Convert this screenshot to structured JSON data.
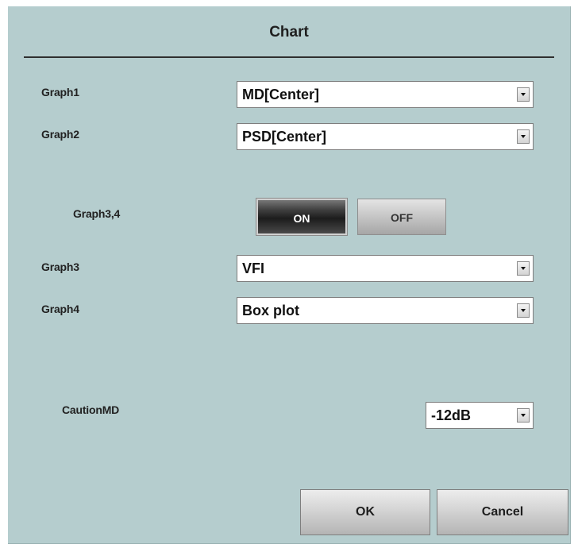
{
  "dialog": {
    "title": "Chart"
  },
  "graph1": {
    "label": "Graph1",
    "value": "MD[Center]"
  },
  "graph2": {
    "label": "Graph2",
    "value": "PSD[Center]"
  },
  "graph34": {
    "label": "Graph3,4",
    "on_label": "ON",
    "off_label": "OFF",
    "selected": "ON"
  },
  "graph3": {
    "label": "Graph3",
    "value": "VFI"
  },
  "graph4": {
    "label": "Graph4",
    "value": "Box plot"
  },
  "caution_md": {
    "label": "CautionMD",
    "value": "-12dB"
  },
  "buttons": {
    "ok_label": "OK",
    "cancel_label": "Cancel"
  },
  "icons": {
    "dropdown": "chevron-down-icon"
  }
}
